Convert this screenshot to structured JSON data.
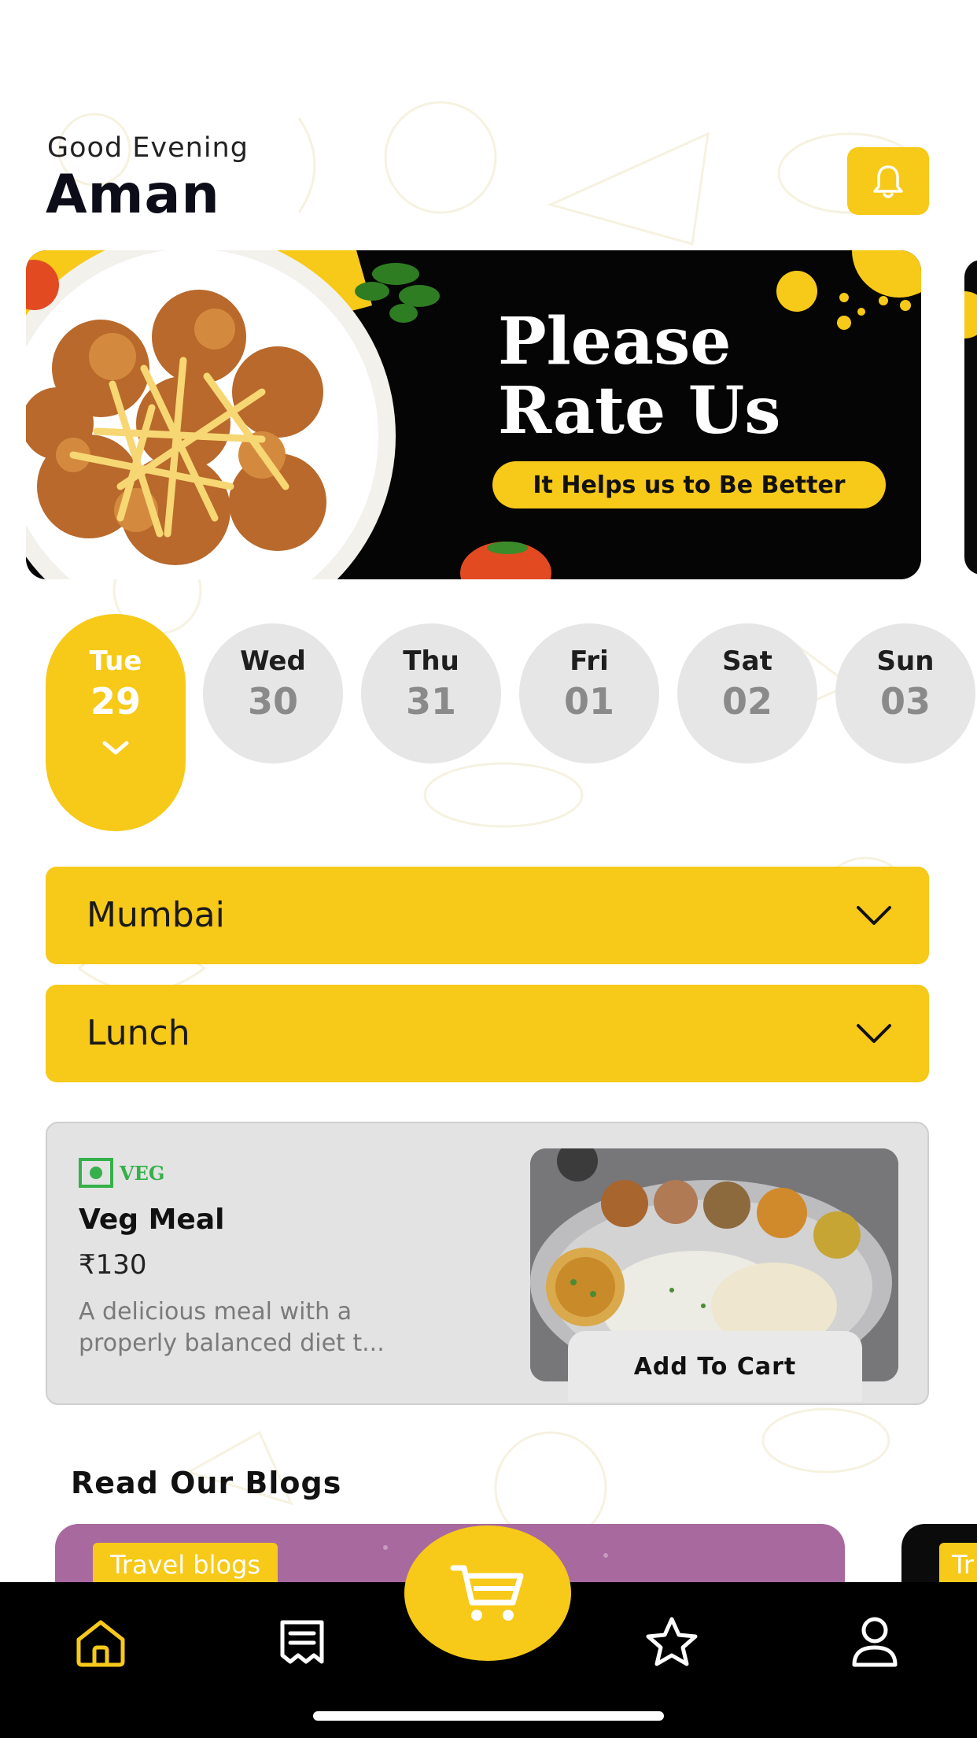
{
  "header": {
    "greeting": "Good Evening",
    "user_name": "Aman",
    "notification_icon": "bell-icon"
  },
  "banner": {
    "title": "Please\nRate Us",
    "subtitle": "It Helps us to Be Better"
  },
  "days": [
    {
      "day": "Tue",
      "date": "29",
      "selected": true
    },
    {
      "day": "Wed",
      "date": "30",
      "selected": false
    },
    {
      "day": "Thu",
      "date": "31",
      "selected": false
    },
    {
      "day": "Fri",
      "date": "01",
      "selected": false
    },
    {
      "day": "Sat",
      "date": "02",
      "selected": false
    },
    {
      "day": "Sun",
      "date": "03",
      "selected": false
    }
  ],
  "filters": {
    "city": "Mumbai",
    "meal_type": "Lunch"
  },
  "meal": {
    "tag": "VEG",
    "name": "Veg Meal",
    "price": "₹130",
    "description": "A delicious meal with a properly balanced diet t...",
    "add_to_cart_label": "Add To Cart"
  },
  "blogs": {
    "section_title": "Read Our Blogs",
    "cards": [
      {
        "category": "Travel blogs"
      },
      {
        "category": "Tr"
      }
    ]
  },
  "nav": {
    "items": [
      "home-icon",
      "orders-icon",
      "cart-icon",
      "favorites-icon",
      "profile-icon"
    ],
    "active": "home-icon"
  },
  "colors": {
    "accent": "#F7C919",
    "veg_green": "#36b04a",
    "nav_background": "#000000"
  }
}
